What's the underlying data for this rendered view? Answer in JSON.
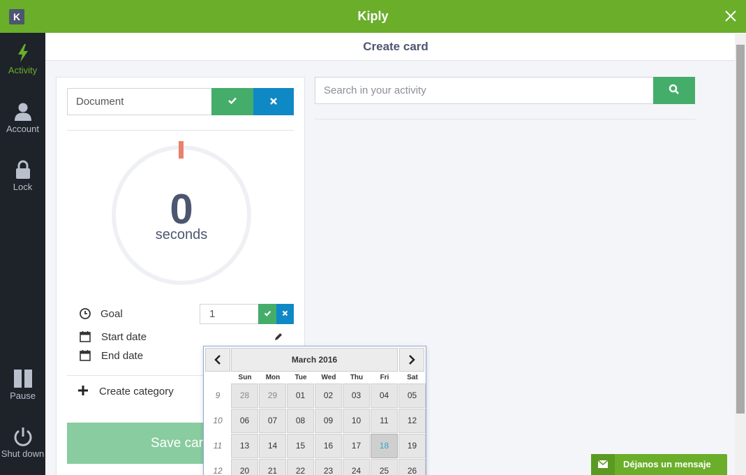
{
  "app": {
    "title": "Kiply",
    "logo_letter": "K"
  },
  "sidebar": {
    "items": [
      {
        "label": "Activity",
        "icon": "bolt-icon",
        "active": true
      },
      {
        "label": "Account",
        "icon": "user-icon"
      },
      {
        "label": "Lock",
        "icon": "lock-icon"
      },
      {
        "label": "Pause",
        "icon": "pause-icon"
      },
      {
        "label": "Shut down",
        "icon": "power-icon"
      }
    ]
  },
  "header": {
    "title": "Create card"
  },
  "card": {
    "name_value": "Document",
    "timer_value": "0",
    "timer_unit": "seconds",
    "goal_label": "Goal",
    "goal_value": "1",
    "start_date_label": "Start date",
    "end_date_label": "End date",
    "create_category_label": "Create category",
    "save_label": "Save card"
  },
  "search": {
    "placeholder": "Search in your activity"
  },
  "datepicker": {
    "title": "March 2016",
    "weekdays": [
      "Sun",
      "Mon",
      "Tue",
      "Wed",
      "Thu",
      "Fri",
      "Sat"
    ],
    "weeks": [
      {
        "number": "9",
        "days": [
          "28",
          "29",
          "01",
          "02",
          "03",
          "04",
          "05"
        ]
      },
      {
        "number": "10",
        "days": [
          "06",
          "07",
          "08",
          "09",
          "10",
          "11",
          "12"
        ]
      },
      {
        "number": "11",
        "days": [
          "13",
          "14",
          "15",
          "16",
          "17",
          "18",
          "19"
        ]
      },
      {
        "number": "12",
        "days": [
          "20",
          "21",
          "22",
          "23",
          "24",
          "25",
          "26"
        ]
      }
    ],
    "today": "18"
  },
  "chat": {
    "label": "Déjanos un mensaje",
    "icon": "envelope-icon"
  },
  "colors": {
    "brand_green": "#6aae2a",
    "ok_green": "#45ad6a",
    "cancel_blue": "#0f88c6",
    "sidebar_bg": "#1e2229",
    "timer_accent": "#e9826a"
  }
}
